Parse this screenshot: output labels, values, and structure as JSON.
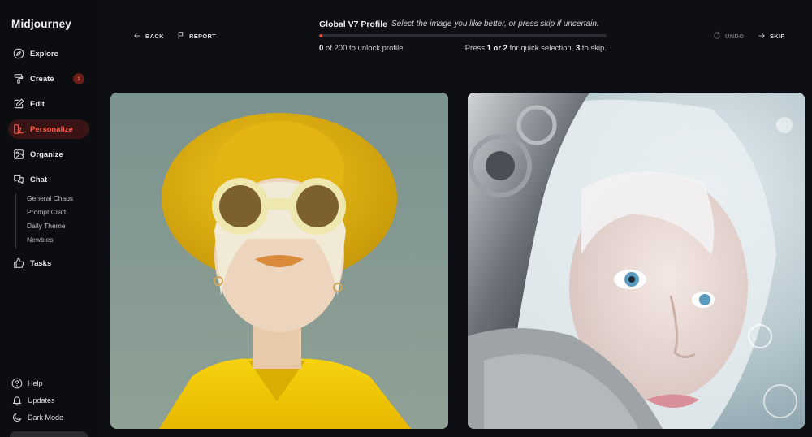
{
  "app": {
    "brand": "Midjourney"
  },
  "sidebar": {
    "items": [
      {
        "label": "Explore",
        "icon": "compass-icon"
      },
      {
        "label": "Create",
        "icon": "brush-icon",
        "badge": "1"
      },
      {
        "label": "Edit",
        "icon": "edit-icon"
      },
      {
        "label": "Personalize",
        "icon": "personalize-icon",
        "active": true
      },
      {
        "label": "Organize",
        "icon": "image-icon"
      },
      {
        "label": "Chat",
        "icon": "chat-icon"
      }
    ],
    "chat_rooms": [
      "General Chaos",
      "Prompt Craft",
      "Daily Theme",
      "Newbies"
    ],
    "tasks": {
      "label": "Tasks",
      "icon": "thumbs-up-icon"
    },
    "bottom": [
      {
        "label": "Help",
        "icon": "help-icon"
      },
      {
        "label": "Updates",
        "icon": "bell-icon"
      },
      {
        "label": "Dark Mode",
        "icon": "moon-icon"
      }
    ]
  },
  "topbar": {
    "back_label": "BACK",
    "report_label": "REPORT",
    "undo_label": "UNDO",
    "skip_label": "SKIP"
  },
  "profile": {
    "title": "Global V7 Profile",
    "hint": "Select the image you like better, or press skip if uncertain.",
    "count_done": "0",
    "count_rest": " of 200 to unlock profile",
    "progress": 0.01,
    "keys_pre": "Press ",
    "keys_a": "1 or 2",
    "keys_mid": " for quick selection, ",
    "keys_b": "3",
    "keys_post": " to skip."
  },
  "colors": {
    "accent": "#ff5a4a",
    "progress": "#e0453a",
    "background": "#0d0f14"
  }
}
